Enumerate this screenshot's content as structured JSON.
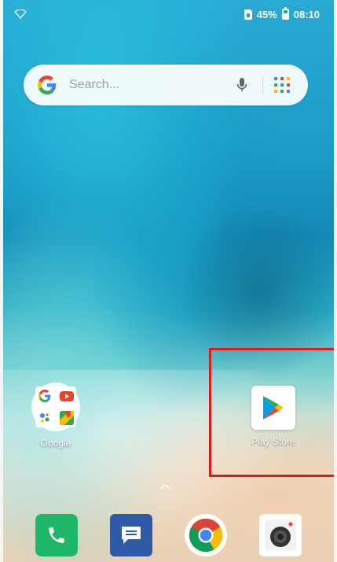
{
  "status_bar": {
    "battery": "45%",
    "time": "08:10",
    "icons": [
      "wifi-icon",
      "sim-icon",
      "battery-icon"
    ]
  },
  "search": {
    "placeholder": "Search...",
    "icons": [
      "google-g-icon",
      "mic-icon",
      "apps-grid-icon"
    ]
  },
  "home_apps": [
    {
      "label": "Google",
      "icon": "google-folder-icon"
    },
    {
      "label": "Play Store",
      "icon": "play-store-icon"
    }
  ],
  "dock": [
    {
      "name": "Phone",
      "icon": "phone-icon"
    },
    {
      "name": "Messages",
      "icon": "messages-icon"
    },
    {
      "name": "Chrome",
      "icon": "chrome-icon"
    },
    {
      "name": "Camera",
      "icon": "camera-icon"
    }
  ],
  "highlight": {
    "target": "Play Store",
    "color": "#e01a1a"
  },
  "colors": {
    "google_blue": "#4285F4",
    "google_red": "#EA4335",
    "google_yellow": "#FBBC05",
    "google_green": "#34A853"
  }
}
